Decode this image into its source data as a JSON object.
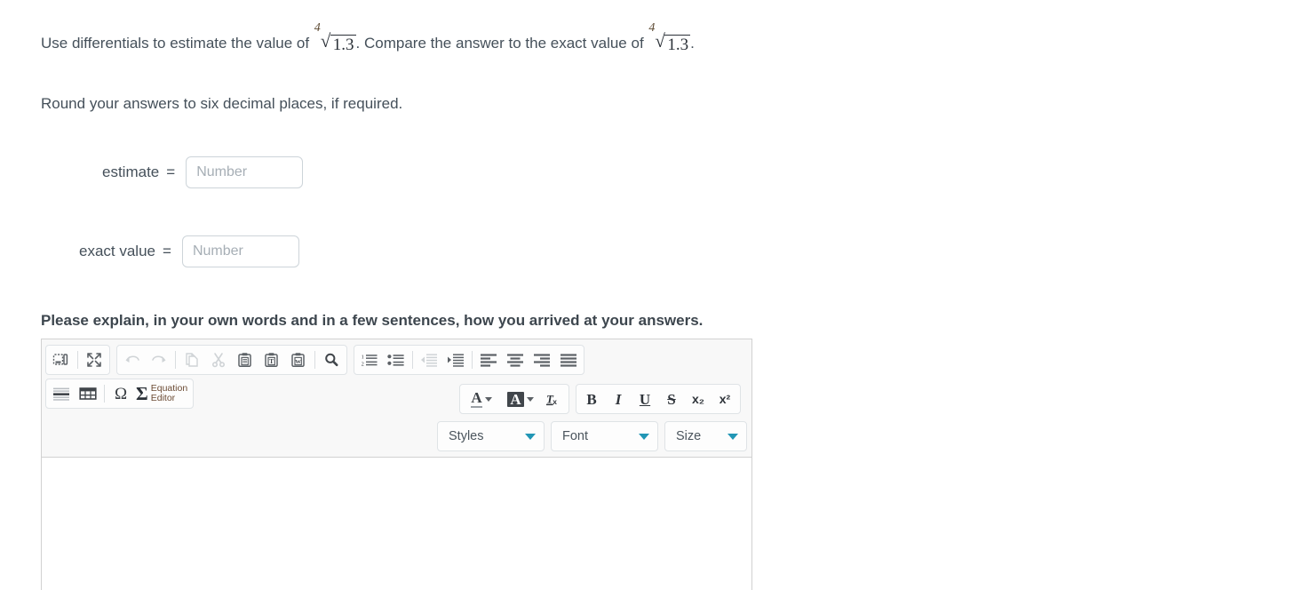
{
  "question": {
    "line1_before": "Use differentials to estimate the value of ",
    "radical1": {
      "index": "4",
      "radicand": "1.3"
    },
    "line1_middle": ". Compare the answer to the exact value of ",
    "radical2": {
      "index": "4",
      "radicand": "1.3"
    },
    "line1_after": ".",
    "line2": "Round your answers to six decimal places, if required."
  },
  "answers": [
    {
      "label": "estimate",
      "equals": "=",
      "placeholder": "Number",
      "value": ""
    },
    {
      "label": "exact value",
      "equals": "=",
      "placeholder": "Number",
      "value": ""
    }
  ],
  "explain_prompt": "Please explain, in your own words and in a few sentences, how you arrived at your answers.",
  "editor": {
    "toolbar": {
      "group_document": [
        {
          "name": "source-icon",
          "title": "Source",
          "disabled": false
        },
        {
          "name": "maximize-icon",
          "title": "Maximize",
          "disabled": false
        }
      ],
      "group_clipboard": [
        {
          "name": "undo-icon",
          "title": "Undo",
          "disabled": true
        },
        {
          "name": "redo-icon",
          "title": "Redo",
          "disabled": true
        },
        {
          "name": "copy-icon",
          "title": "Copy",
          "disabled": true
        },
        {
          "name": "cut-icon",
          "title": "Cut",
          "disabled": true
        },
        {
          "name": "paste-icon",
          "title": "Paste",
          "disabled": false
        },
        {
          "name": "paste-as-text-icon",
          "title": "Paste as plain text",
          "disabled": false
        },
        {
          "name": "paste-from-word-icon",
          "title": "Paste from Word",
          "disabled": false
        },
        {
          "name": "find-icon",
          "title": "Find",
          "disabled": false
        }
      ],
      "group_paragraph": [
        {
          "name": "numbered-list-icon",
          "title": "Insert/Remove Numbered List",
          "disabled": false
        },
        {
          "name": "bulleted-list-icon",
          "title": "Insert/Remove Bulleted List",
          "disabled": false
        },
        {
          "name": "outdent-icon",
          "title": "Decrease Indent",
          "disabled": true
        },
        {
          "name": "indent-icon",
          "title": "Increase Indent",
          "disabled": false
        },
        {
          "name": "align-left-icon",
          "title": "Align Left",
          "disabled": false
        },
        {
          "name": "align-center-icon",
          "title": "Center",
          "disabled": false
        },
        {
          "name": "align-right-icon",
          "title": "Align Right",
          "disabled": false
        },
        {
          "name": "justify-icon",
          "title": "Justify",
          "disabled": false
        }
      ],
      "group_insert": [
        {
          "name": "horizontal-rule-icon",
          "title": "Insert Horizontal Line",
          "disabled": false
        },
        {
          "name": "table-icon",
          "title": "Table",
          "disabled": false
        },
        {
          "name": "special-char-icon",
          "title": "Insert Special Character",
          "glyph": "Ω",
          "disabled": false
        }
      ],
      "equation_editor": {
        "glyph": "Σ",
        "label": "Equation\nEditor"
      },
      "group_color": [
        {
          "name": "text-color-icon",
          "title": "Text Color",
          "glyph": "A"
        },
        {
          "name": "background-color-icon",
          "title": "Background Color",
          "glyph": "A"
        },
        {
          "name": "remove-format-icon",
          "title": "Remove Format",
          "glyph": "Tx"
        }
      ],
      "group_basic_styles": [
        {
          "name": "bold-icon",
          "title": "Bold",
          "glyph": "B"
        },
        {
          "name": "italic-icon",
          "title": "Italic",
          "glyph": "I"
        },
        {
          "name": "underline-icon",
          "title": "Underline",
          "glyph": "U"
        },
        {
          "name": "strikethrough-icon",
          "title": "Strike Through",
          "glyph": "S"
        },
        {
          "name": "subscript-icon",
          "title": "Subscript",
          "glyph": "x₂"
        },
        {
          "name": "superscript-icon",
          "title": "Superscript",
          "glyph": "x²"
        }
      ],
      "selects": [
        {
          "name": "styles-select",
          "label": "Styles"
        },
        {
          "name": "font-select",
          "label": "Font"
        },
        {
          "name": "size-select",
          "label": "Size"
        }
      ]
    },
    "content": ""
  },
  "colors": {
    "text": "#45505a",
    "accent_caret": "#2196b5",
    "equation_label": "#6b4a33",
    "border": "#d1d1d1",
    "toolbar_bg": "#f8f8f8",
    "placeholder": "#a6aeb5"
  }
}
